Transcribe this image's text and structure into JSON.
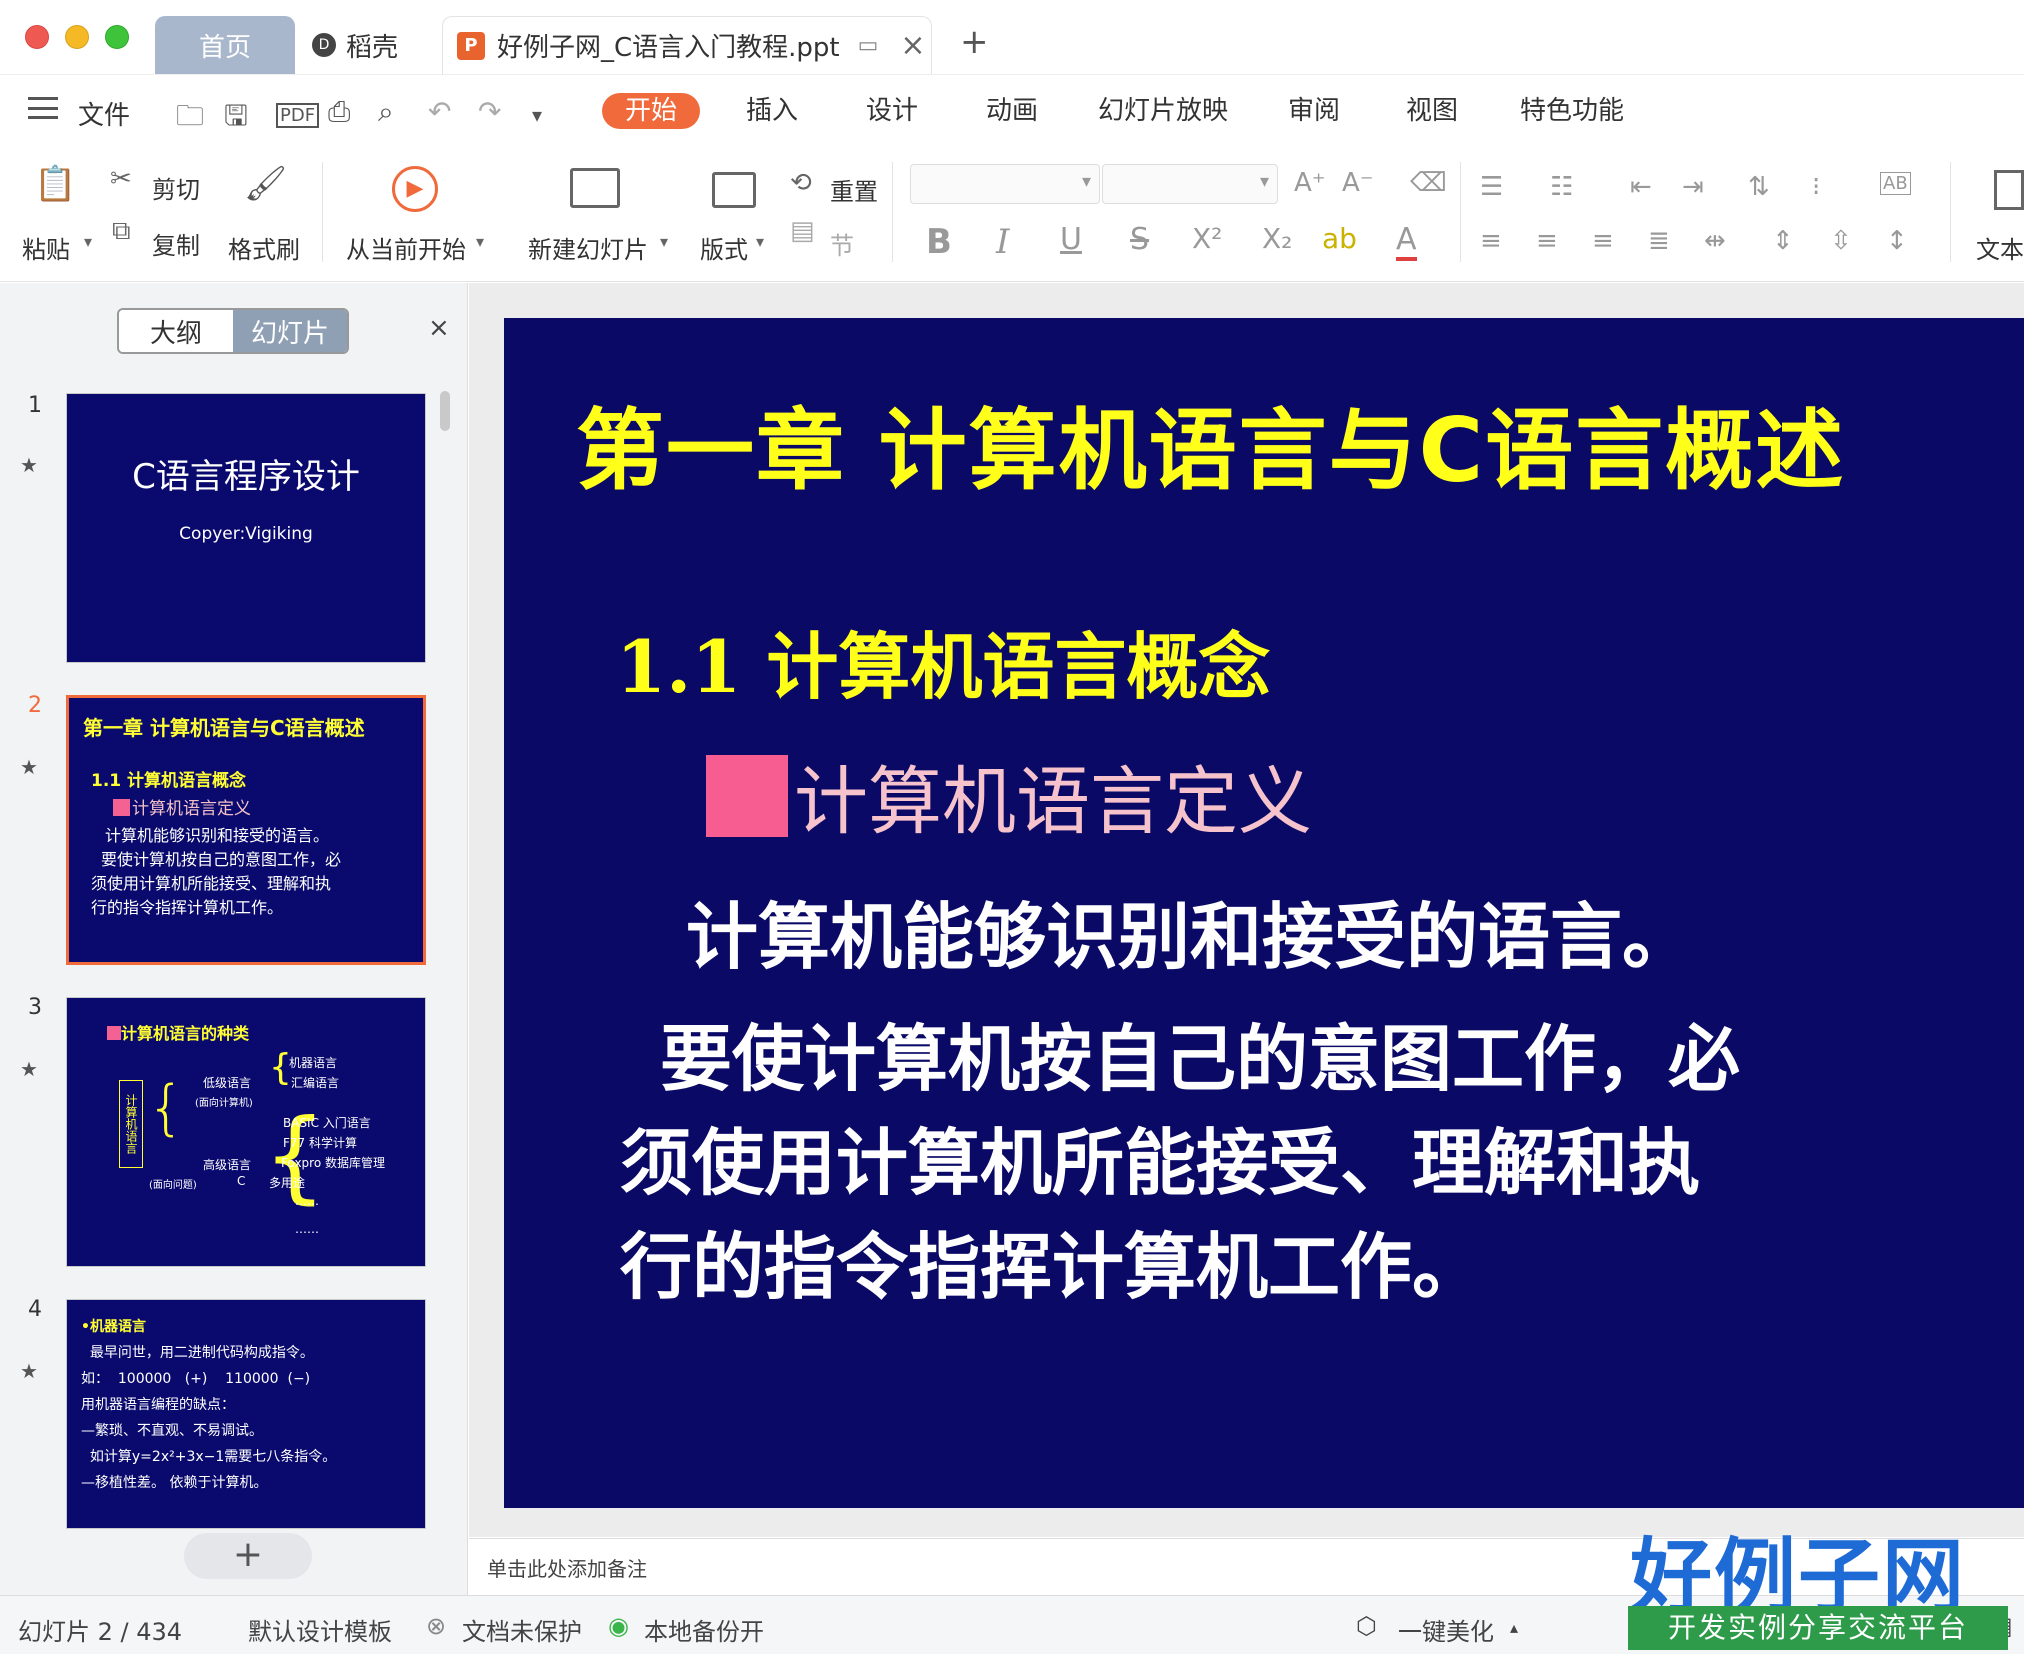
{
  "titlebar": {
    "tabs": [
      {
        "label": "首页"
      },
      {
        "label": "稻壳"
      },
      {
        "label": "好例子网_C语言入门教程.ppt"
      }
    ],
    "new_tab": "+"
  },
  "menubar": {
    "file_label": "文件",
    "items": [
      "开始",
      "插入",
      "设计",
      "动画",
      "幻灯片放映",
      "审阅",
      "视图",
      "特色功能"
    ]
  },
  "ribbon": {
    "paste": "粘贴",
    "cut": "剪切",
    "copy": "复制",
    "format_painter": "格式刷",
    "play_from_current": "从当前开始",
    "new_slide": "新建幻灯片",
    "layout": "版式",
    "reset": "重置",
    "section": "节",
    "text": "文本"
  },
  "left_panel": {
    "tab_outline": "大纲",
    "tab_slides": "幻灯片",
    "close": "×",
    "add": "+",
    "slides": [
      {
        "num": "1",
        "title": "C语言程序设计",
        "subtitle": "Copyer:Vigiking"
      },
      {
        "num": "2",
        "title": "第一章  计算机语言与C语言概述",
        "section": "1.1  计算机语言概念",
        "definition": "计算机语言定义",
        "body": [
          "计算机能够识别和接受的语言。",
          "要使计算机按自己的意图工作，必",
          "须使用计算机所能接受、理解和执",
          "行的指令指挥计算机工作。"
        ]
      },
      {
        "num": "3",
        "heading": "计算机语言的种类",
        "root": "计算机语言",
        "low": "低级语言",
        "low_note": "(面向计算机)",
        "machine": "机器语言",
        "assembly": "汇编语言",
        "high": "高级语言",
        "high_note": "(面向问题)",
        "basic": "BASIC  入门语言",
        "f77": "F77    科学计算",
        "foxpro": "Foxpro  数据库管理",
        "c": "C",
        "multi": "多用途",
        "dots1": "……",
        "dots2": "……"
      },
      {
        "num": "4",
        "lines": [
          "•机器语言",
          "  最早问世，用二进制代码构成指令。",
          "如：  100000   (+)    110000  (−)",
          "用机器语言编程的缺点：",
          "—繁琐、不直观、不易调试。",
          "  如计算y=2x²+3x−1需要七八条指令。",
          "—移植性差。 依赖于计算机。"
        ]
      }
    ]
  },
  "slide": {
    "title": "第一章   计算机语言与C语言概述",
    "section": "1.1  计算机语言概念",
    "definition": "计算机语言定义",
    "body": [
      "计算机能够识别和接受的语言。",
      "要使计算机按自己的意图工作，必",
      "须使用计算机所能接受、理解和执",
      "行的指令指挥计算机工作。"
    ]
  },
  "notes_placeholder": "单击此处添加备注",
  "statusbar": {
    "slide_counter": "幻灯片 2 / 434",
    "template": "默认设计模板",
    "protection": "文档未保护",
    "backup": "本地备份开",
    "beautify": "一键美化"
  },
  "watermark": {
    "main": "好例子网",
    "sub": "开发实例分享交流平台"
  },
  "colors": {
    "accent": "#f06a3b",
    "slide_bg": "#0a0a66",
    "title_yellow": "#ffff1a"
  }
}
